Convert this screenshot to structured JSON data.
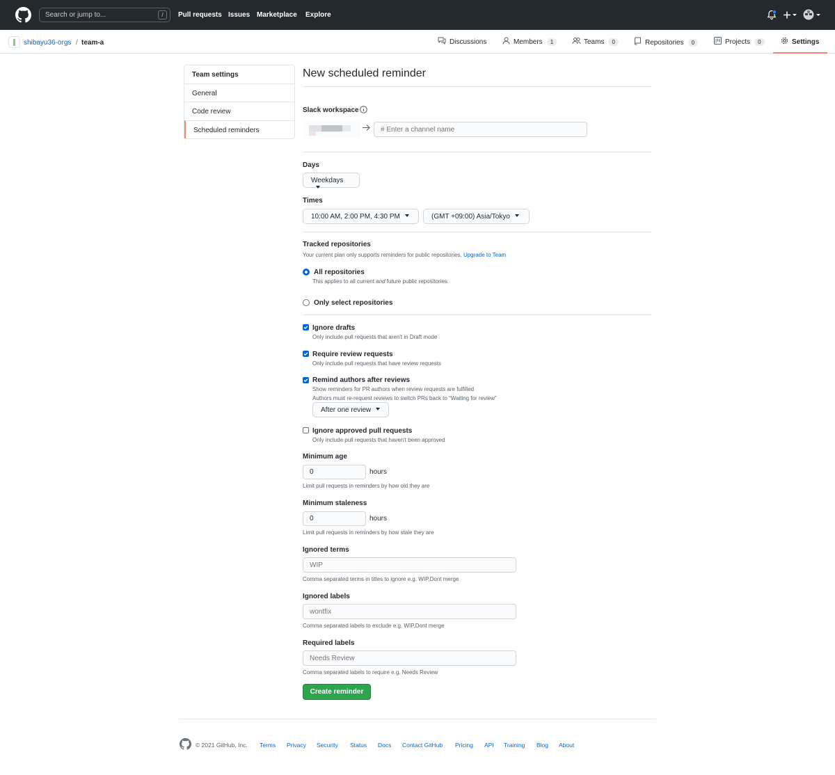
{
  "topnav": {
    "search_placeholder": "Search or jump to...",
    "slash": "/",
    "links": [
      "Pull requests",
      "Issues",
      "Marketplace",
      "Explore"
    ]
  },
  "breadcrumb": {
    "org": "shibayu36-orgs",
    "team": "team-a"
  },
  "tabs": [
    {
      "label": "Discussions"
    },
    {
      "label": "Members",
      "count": "1"
    },
    {
      "label": "Teams",
      "count": "0"
    },
    {
      "label": "Repositories",
      "count": "0"
    },
    {
      "label": "Projects",
      "count": "0"
    },
    {
      "label": "Settings"
    }
  ],
  "sidebar": {
    "title": "Team settings",
    "items": [
      "General",
      "Code review",
      "Scheduled reminders"
    ]
  },
  "main": {
    "title": "New scheduled reminder",
    "slack_label": "Slack workspace",
    "channel_placeholder": "# Enter a channel name",
    "days_label": "Days",
    "days_value": "Weekdays",
    "times_label": "Times",
    "times_value": "10:00 AM, 2:00 PM, 4:30 PM",
    "timezone_value": "(GMT +09:00) Asia/Tokyo",
    "tracked_label": "Tracked repositories",
    "tracked_note": "Your current plan only supports reminders for public repositories.",
    "upgrade_link": "Upgrade to Team",
    "radio_all_label": "All repositories",
    "radio_all_note_a": "This applies to all current",
    "radio_all_note_em": "and",
    "radio_all_note_b": "future public repositories.",
    "radio_select_label": "Only select repositories",
    "ignore_drafts_label": "Ignore drafts",
    "ignore_drafts_note": "Only include pull requests that aren't in Draft mode",
    "require_review_label": "Require review requests",
    "require_review_note": "Only include pull requests that have review requests",
    "remind_authors_label": "Remind authors after reviews",
    "remind_authors_note1": "Show reminders for PR authors when review requests are fulfilled",
    "remind_authors_note2": "Authors must re-request reviews to switch PRs back to “Waiting for review”",
    "after_review_value": "After one review",
    "ignore_approved_label": "Ignore approved pull requests",
    "ignore_approved_note": "Only include pull requests that haven't been approved",
    "min_age_label": "Minimum age",
    "min_age_value": "0",
    "hours": "hours",
    "min_age_note": "Limit pull requests in reminders by how old they are",
    "min_stale_label": "Minimum staleness",
    "min_stale_value": "0",
    "min_stale_note": "Limit pull requests in reminders by how stale they are",
    "ignored_terms_label": "Ignored terms",
    "ignored_terms_placeholder": "WIP",
    "ignored_terms_note": "Comma separated terms in titles to ignore e.g. WIP,Dont merge",
    "ignored_labels_label": "Ignored labels",
    "ignored_labels_placeholder": "wontfix",
    "ignored_labels_note": "Comma separated labels to exclude e.g. WIP,Dont merge",
    "required_labels_label": "Required labels",
    "required_labels_placeholder": "Needs Review",
    "required_labels_note": "Comma separated labels to require e.g. Needs Review",
    "create_button": "Create reminder"
  },
  "footer": {
    "copyright": "© 2021 GitHub, Inc.",
    "links": [
      "Terms",
      "Privacy",
      "Security",
      "Status",
      "Docs",
      "Contact GitHub",
      "Pricing",
      "API",
      "Training",
      "Blog",
      "About"
    ]
  },
  "colors": {
    "header_bg": "#24292e",
    "link": "#0366d6",
    "primary_button": "#2ea44f",
    "active_tab_underline": "#f9826c"
  }
}
